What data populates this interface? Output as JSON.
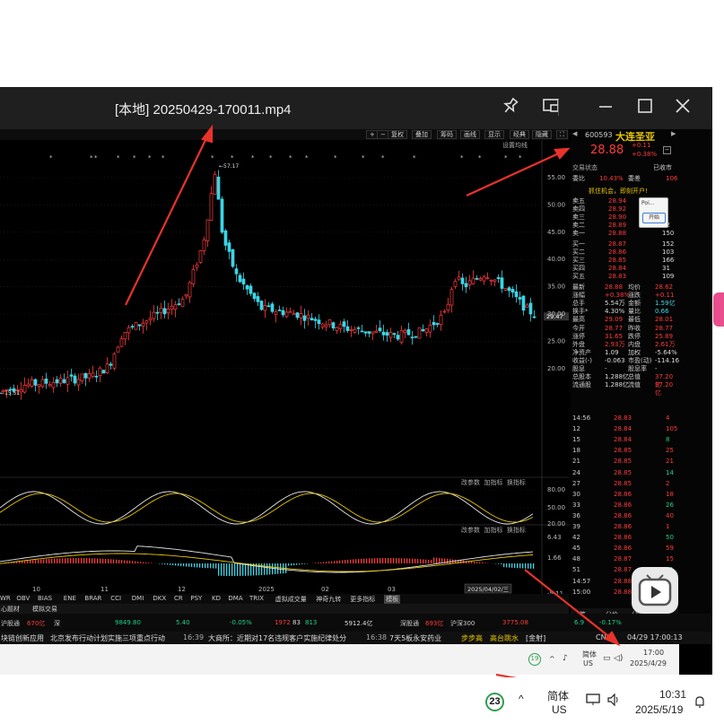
{
  "window": {
    "title": "[本地] 20250429-170011.mp4",
    "buttons": [
      "pin-icon",
      "picture-in-picture-icon",
      "minimize-icon",
      "maximize-icon",
      "close-icon"
    ]
  },
  "chart_toolbar": [
    "复权",
    "叠加",
    "筹码",
    "画线",
    "显示",
    "经典",
    "隐藏"
  ],
  "setting_label": "设置均线",
  "main_chart": {
    "y_ticks": [
      "55.00",
      "50.00",
      "45.00",
      "40.00",
      "35.00",
      "30.00",
      "25.00",
      "20.00"
    ],
    "high_label": "57.17",
    "low_label": "15.51",
    "current_price_tag": "29.47",
    "x_labels": [
      "10",
      "11",
      "12",
      "2025",
      "02",
      "03"
    ],
    "date_box": "2025/04/02/三"
  },
  "indicator1": {
    "buttons": [
      "改参数",
      "加指标",
      "换指标"
    ],
    "y_ticks": [
      "80.00",
      "50.00",
      "20.00"
    ]
  },
  "indicator2": {
    "buttons": [
      "改参数",
      "加指标",
      "换指标"
    ],
    "y_ticks": [
      "6.43",
      "1.66",
      "-5.11"
    ]
  },
  "indicator_tabs": [
    "WR",
    "OBV",
    "BIAS",
    "ENE",
    "BRAR",
    "CCI",
    "DMI",
    "DKX",
    "CR",
    "PSY",
    "KD",
    "DMA",
    "TRIX",
    "虚拟成交量",
    "神奇九转",
    "更多指标",
    "模板"
  ],
  "bottom_tabs": [
    "心题材",
    "模拟交易"
  ],
  "quote": {
    "code": "600593",
    "name": "大连圣亚",
    "price": "28.88",
    "change": "+0.11",
    "change_pct": "+0.38%",
    "status_label": "交易状态",
    "status_value": "已收市",
    "wei_bi_label": "委比",
    "wei_bi": "10.43%",
    "wei_cha_label": "委差",
    "wei_cha": "106",
    "banner": "抓住机会，即刻开户!",
    "popup": {
      "title": "Poi...",
      "button": "开始"
    },
    "asks": [
      {
        "label": "卖五",
        "price": "28.94",
        "vol": ""
      },
      {
        "label": "卖四",
        "price": "28.92",
        "vol": ""
      },
      {
        "label": "卖三",
        "price": "28.90",
        "vol": ""
      },
      {
        "label": "卖二",
        "price": "28.89",
        "vol": "62"
      },
      {
        "label": "卖一",
        "price": "28.88",
        "vol": "150"
      }
    ],
    "bids": [
      {
        "label": "买一",
        "price": "28.87",
        "vol": "152"
      },
      {
        "label": "买二",
        "price": "28.86",
        "vol": "103"
      },
      {
        "label": "买三",
        "price": "28.85",
        "vol": "166"
      },
      {
        "label": "买四",
        "price": "28.84",
        "vol": "31"
      },
      {
        "label": "买五",
        "price": "28.83",
        "vol": "109"
      }
    ],
    "stats": [
      [
        "最新",
        "28.88",
        "均价",
        "28.62"
      ],
      [
        "涨幅",
        "+0.38%",
        "涨跌",
        "+0.11"
      ],
      [
        "总手",
        "5.54万",
        "金额",
        "1.59亿"
      ],
      [
        "换手*",
        "4.30%",
        "量比",
        "0.66"
      ],
      [
        "最高",
        "29.09",
        "最低",
        "28.01"
      ],
      [
        "今开",
        "28.77",
        "昨收",
        "28.77"
      ],
      [
        "涨停",
        "31.65",
        "跌停",
        "25.89"
      ],
      [
        "外盘",
        "2.93万",
        "内盘",
        "2.61万"
      ],
      [
        "净资产",
        "1.09",
        "加权",
        "-5.64%"
      ],
      [
        "收益(-)",
        "-0.063",
        "市盈(动)",
        "-114.16"
      ],
      [
        "股息",
        "-",
        "股息率",
        "-"
      ],
      [
        "总股本",
        "1.288亿",
        "总值",
        "37.20亿"
      ],
      [
        "流通股",
        "1.288亿",
        "流值",
        "37.20亿"
      ]
    ],
    "ticks": [
      [
        "14:56",
        "28.83",
        "4"
      ],
      [
        "12",
        "28.84",
        "105"
      ],
      [
        "15",
        "28.84",
        "8"
      ],
      [
        "18",
        "28.85",
        "25"
      ],
      [
        "21",
        "28.85",
        "21"
      ],
      [
        "24",
        "28.85",
        "14"
      ],
      [
        "27",
        "28.85",
        "2"
      ],
      [
        "30",
        "28.86",
        "18"
      ],
      [
        "33",
        "28.86",
        "26"
      ],
      [
        "36",
        "28.86",
        "40"
      ],
      [
        "39",
        "28.86",
        "1"
      ],
      [
        "42",
        "28.86",
        "50"
      ],
      [
        "45",
        "28.86",
        "59"
      ],
      [
        "48",
        "28.87",
        "15"
      ],
      [
        "51",
        "28.87",
        "31"
      ],
      [
        "14:57",
        "28.88",
        ""
      ],
      [
        "15:00",
        "28.88",
        ""
      ]
    ],
    "bottom_tabs": [
      "笔",
      "分价",
      "分时",
      "异动"
    ]
  },
  "index_bar": {
    "hgt_label": "沪股通",
    "hgt_val": "670亿",
    "sh_label": "深",
    "sh_val": "9849.80",
    "sh_chg": "5.40",
    "sh_pct": "-0.05%",
    "vol1": "1972",
    "vol2": "83",
    "vol3": "813",
    "amt": "5912.4亿",
    "sgt_label": "深股通",
    "sgt_val": "693亿",
    "hs300_label": "沪深300",
    "hs300_val": "3775.08",
    "right_pct": "6.9",
    "right_pct2": "-0.17%"
  },
  "news_bar": {
    "items": [
      "块链创新应用",
      "北京发布行动计划实施三项重点行动",
      "16:39",
      "大商所：近期对17名违规客户实施纪律处分",
      "16:38",
      "7天5板永安药业"
    ],
    "tags": [
      "步步高",
      "高台跳水"
    ],
    "label": "[金射]"
  },
  "inner_taskbar": {
    "badge": "19",
    "lang": "简体",
    "lang2": "US",
    "extra": "CN",
    "time": "17:00",
    "date": "2025/4/29",
    "clock": "04/29 17:00:13"
  },
  "taskbar": {
    "badge": "23",
    "lang": "简体",
    "lang2": "US",
    "time": "10:31",
    "date": "2025/5/19"
  }
}
